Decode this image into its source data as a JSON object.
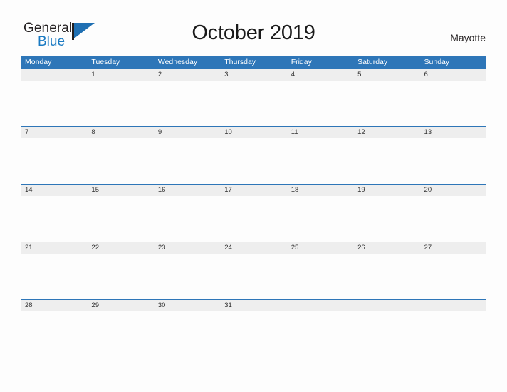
{
  "brand": {
    "name_top": "General",
    "name_bottom": "Blue",
    "flag_icon": "flag-triangle-icon",
    "accent_color": "#1f6fb2",
    "text_color": "#231f20"
  },
  "header": {
    "title": "October 2019",
    "region": "Mayotte"
  },
  "calendar": {
    "header_bg": "#2e76b8",
    "date_strip_bg": "#eeeeee",
    "grid_line_color": "#2e76b8",
    "day_names": [
      "Monday",
      "Tuesday",
      "Wednesday",
      "Thursday",
      "Friday",
      "Saturday",
      "Sunday"
    ],
    "weeks": [
      [
        "",
        "1",
        "2",
        "3",
        "4",
        "5",
        "6"
      ],
      [
        "7",
        "8",
        "9",
        "10",
        "11",
        "12",
        "13"
      ],
      [
        "14",
        "15",
        "16",
        "17",
        "18",
        "19",
        "20"
      ],
      [
        "21",
        "22",
        "23",
        "24",
        "25",
        "26",
        "27"
      ],
      [
        "28",
        "29",
        "30",
        "31",
        "",
        "",
        ""
      ]
    ]
  }
}
